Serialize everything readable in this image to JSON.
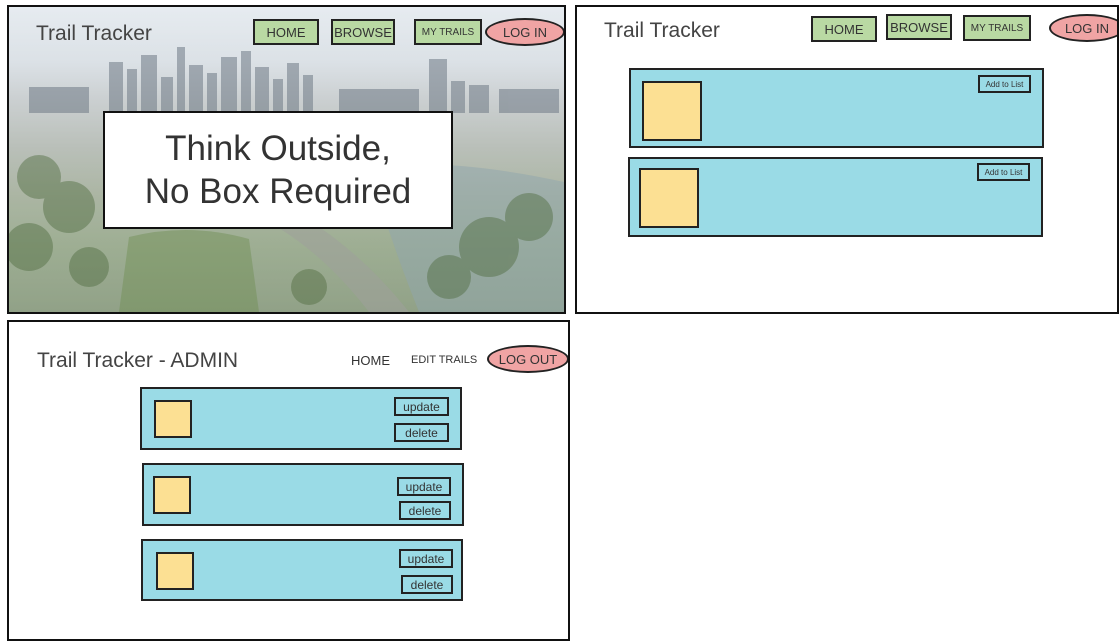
{
  "home": {
    "title": "Trail Tracker",
    "nav": {
      "home": "HOME",
      "browse": "BROWSE",
      "my_trails": "MY TRAILS",
      "login": "LOG IN"
    },
    "hero": {
      "line1": "Think Outside,",
      "line2": "No Box Required"
    }
  },
  "browse": {
    "title": "Trail Tracker",
    "nav": {
      "home": "HOME",
      "browse": "BROWSE",
      "my_trails": "MY TRAILS",
      "login": "LOG IN"
    },
    "cards": [
      {
        "add_label": "Add to List"
      },
      {
        "add_label": "Add to List"
      }
    ]
  },
  "admin": {
    "title": "Trail Tracker  - ADMIN",
    "nav": {
      "home": "HOME",
      "edit_trails": "EDIT TRAILS",
      "logout": "LOG OUT"
    },
    "cards": [
      {
        "update_label": "update",
        "delete_label": "delete"
      },
      {
        "update_label": "update",
        "delete_label": "delete"
      },
      {
        "update_label": "update",
        "delete_label": "delete"
      }
    ]
  },
  "colors": {
    "nav_green": "#b9d9a3",
    "pill_red": "#f0a4a4",
    "card_cyan": "#9adbe6",
    "thumb_yellow": "#fce093"
  }
}
